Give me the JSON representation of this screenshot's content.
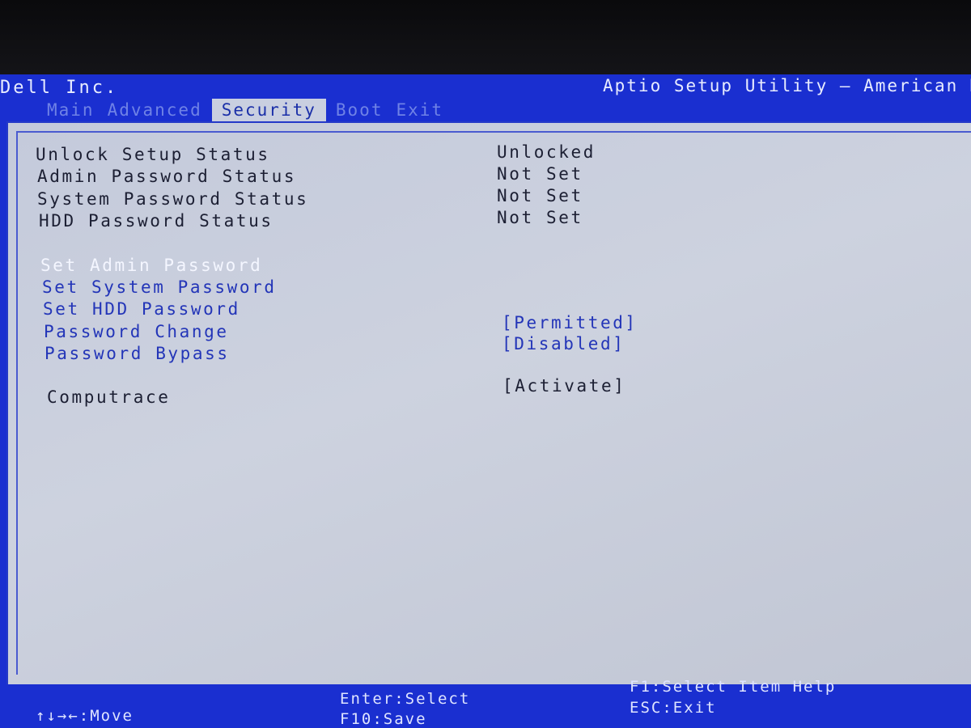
{
  "header": {
    "vendor": "Dell Inc.",
    "utility": "Aptio Setup Utility – American M"
  },
  "tabs": [
    {
      "label": "Main"
    },
    {
      "label": "Advanced"
    },
    {
      "label": "Security"
    },
    {
      "label": "Boot"
    },
    {
      "label": "Exit"
    }
  ],
  "status": [
    {
      "label": "Unlock Setup Status",
      "value": "Unlocked"
    },
    {
      "label": "Admin Password Status",
      "value": "Not Set"
    },
    {
      "label": "System Password Status",
      "value": "Not Set"
    },
    {
      "label": "HDD Password Status",
      "value": "Not Set"
    }
  ],
  "options": [
    {
      "label": "Set Admin Password",
      "value": ""
    },
    {
      "label": "Set System Password",
      "value": ""
    },
    {
      "label": "Set HDD Password",
      "value": ""
    },
    {
      "label": "Password Change",
      "value": "[Permitted]"
    },
    {
      "label": "Password Bypass",
      "value": "[Disabled]"
    },
    {
      "label": "Computrace",
      "value": "[Activate]"
    }
  ],
  "help": {
    "move": "↑↓→←:Move",
    "enter": "Enter:Select",
    "save": "F10:Save",
    "f1": "F1:Select Item Help",
    "esc": "ESC:Exit"
  },
  "colors": {
    "frame": "#1a2fd0",
    "panel": "#c9cfe0",
    "option_text": "#2335b8",
    "highlight_text": "#f4f6ff"
  }
}
